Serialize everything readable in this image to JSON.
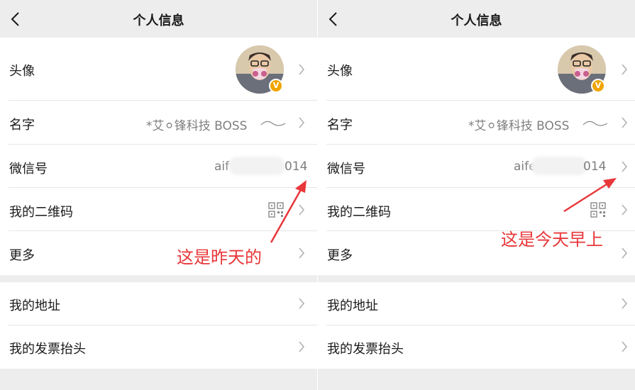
{
  "left": {
    "title": "个人信息",
    "rows": [
      {
        "label": "头像"
      },
      {
        "label": "名字",
        "value": "*艾⚪锋科技 BOSS"
      },
      {
        "label": "微信号",
        "value_prefix": "aif",
        "value_suffix": "014"
      },
      {
        "label": "我的二维码"
      },
      {
        "label": "更多"
      }
    ],
    "rows2": [
      {
        "label": "我的地址"
      },
      {
        "label": "我的发票抬头"
      }
    ],
    "badge": "V",
    "annotation": "这是昨天的"
  },
  "right": {
    "title": "个人信息",
    "rows": [
      {
        "label": "头像"
      },
      {
        "label": "名字",
        "value": "*艾⚪锋科技 BOSS"
      },
      {
        "label": "微信号",
        "value_prefix": "aife",
        "value_suffix": "014"
      },
      {
        "label": "我的二维码"
      },
      {
        "label": "更多"
      }
    ],
    "rows2": [
      {
        "label": "我的地址"
      },
      {
        "label": "我的发票抬头"
      }
    ],
    "badge": "V",
    "annotation": "这是今天早上"
  },
  "colors": {
    "annotation": "#e8373a",
    "badge": "#f0a500",
    "background": "#ededed"
  }
}
